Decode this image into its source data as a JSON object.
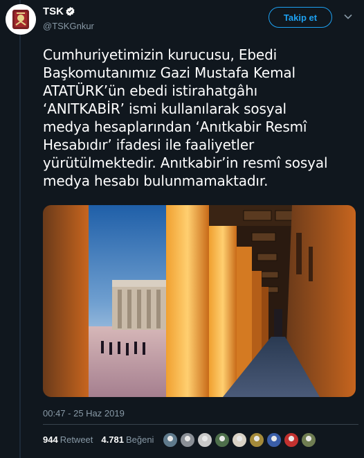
{
  "user": {
    "name": "TSK",
    "handle": "@TSKGnkur",
    "follow_label": "Takip et"
  },
  "tweet": {
    "text_lines": [
      "Cumhuriyetimizin kurucusu, Ebedi",
      "Başkomutanımız Gazi Mustafa Kemal",
      "ATATÜRK’ün ebedi istirahatgâhı",
      "‘ANITKABİR’ ismi kullanılarak sosyal",
      "medya hesaplarından ‘Anıtkabir Resmî",
      "Hesabıdır’ ifadesi ile faaliyetler",
      "yürütülmektedir. Anıtkabir’in resmî sosyal",
      "medya hesabı bulunmamaktadır."
    ],
    "timestamp": "00:47 - 25 Haz 2019"
  },
  "stats": {
    "retweet_count": "944",
    "retweet_label": "Retweet",
    "like_count": "4.781",
    "like_label": "Beğeni"
  },
  "likers": [
    "#5f7a8c",
    "#8a8f96",
    "#c9c9c9",
    "#4e6f4b",
    "#d9d2c5",
    "#a48a3a",
    "#3a5ea8",
    "#c2312f",
    "#6f7d52"
  ],
  "colors": {
    "accent": "#1da1f2",
    "background": "#10171e",
    "muted": "#8899a6",
    "verified": "#1da1f2"
  },
  "icons": {
    "verified": "verified-badge-icon",
    "menu": "chevron-down-icon"
  }
}
